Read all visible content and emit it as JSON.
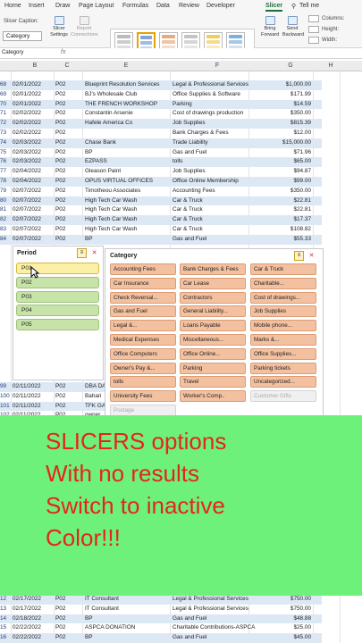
{
  "ribbon_tabs": [
    "Home",
    "Insert",
    "Draw",
    "Page Layout",
    "Formulas",
    "Data",
    "Review",
    "Developer",
    "Slicer",
    "Tell me"
  ],
  "ribbon": {
    "caption_label": "Slicer Caption:",
    "caption_value": "Category",
    "slicer_settings": "Slicer Settings",
    "report_connections": "Report Connections",
    "bring_forward": "Bring Forward",
    "send_backward": "Send Backward",
    "columns_label": "Columns:",
    "height_label": "Height:",
    "width_label": "Width:"
  },
  "formula_bar": {
    "name_box": "Category",
    "fx": "fx"
  },
  "columns": [
    "B",
    "C",
    "E",
    "F",
    "G",
    "H"
  ],
  "rows_top": [
    {
      "n": "68",
      "date": "02/01/2022",
      "p": "P02",
      "payee": "Blueprint Resolution Services",
      "cat": "Legal & Professional Services",
      "amt": "$1,000.00"
    },
    {
      "n": "69",
      "date": "02/01/2022",
      "p": "P02",
      "payee": "BJ's Wholesale Club",
      "cat": "Office Supplies & Software",
      "amt": "$171.99"
    },
    {
      "n": "70",
      "date": "02/01/2022",
      "p": "P02",
      "payee": "THE FRENCH WORKSHOP",
      "cat": "Parking",
      "amt": "$14.59"
    },
    {
      "n": "71",
      "date": "02/02/2022",
      "p": "P02",
      "payee": "Constantin Arsenie",
      "cat": "Cost of drawings production",
      "amt": "$350.00"
    },
    {
      "n": "72",
      "date": "02/02/2022",
      "p": "P02",
      "payee": "Hafele America Co",
      "cat": "Job Supplies",
      "amt": "$815.39"
    },
    {
      "n": "73",
      "date": "02/02/2022",
      "p": "P02",
      "payee": "",
      "cat": "Bank Charges & Fees",
      "amt": "$12.00"
    },
    {
      "n": "74",
      "date": "02/03/2022",
      "p": "P02",
      "payee": "Chase Bank",
      "cat": "Trade Liability",
      "amt": "$15,000.00"
    },
    {
      "n": "75",
      "date": "02/03/2022",
      "p": "P02",
      "payee": "BP",
      "cat": "Gas and Fuel",
      "amt": "$71.96"
    },
    {
      "n": "76",
      "date": "02/03/2022",
      "p": "P02",
      "payee": "EZPASS",
      "cat": "tolls",
      "amt": "$65.00"
    },
    {
      "n": "77",
      "date": "02/04/2022",
      "p": "P02",
      "payee": "Gleason Paint",
      "cat": "Job Supplies",
      "amt": "$94.87"
    },
    {
      "n": "78",
      "date": "02/04/2022",
      "p": "P02",
      "payee": "OPUS VIRTUAL OFFICES",
      "cat": "Office Online Membership",
      "amt": "$99.00"
    },
    {
      "n": "79",
      "date": "02/07/2022",
      "p": "P02",
      "payee": "Timotheou Associates",
      "cat": "Accounting Fees",
      "amt": "$350.00"
    },
    {
      "n": "80",
      "date": "02/07/2022",
      "p": "P02",
      "payee": "High Tech Car Wash",
      "cat": "Car & Truck",
      "amt": "$22.81"
    },
    {
      "n": "81",
      "date": "02/07/2022",
      "p": "P02",
      "payee": "High Tech Car Wash",
      "cat": "Car & Truck",
      "amt": "$22.81"
    },
    {
      "n": "82",
      "date": "02/07/2022",
      "p": "P02",
      "payee": "High Tech Car Wash",
      "cat": "Car & Truck",
      "amt": "$17.37"
    },
    {
      "n": "83",
      "date": "02/07/2022",
      "p": "P02",
      "payee": "High Tech Car Wash",
      "cat": "Car & Truck",
      "amt": "$108.82"
    },
    {
      "n": "84",
      "date": "02/07/2022",
      "p": "P02",
      "payee": "BP",
      "cat": "Gas and Fuel",
      "amt": "$55.33"
    }
  ],
  "rows_mid": [
    {
      "n": "99",
      "date": "02/11/2022",
      "p": "P02",
      "payee": "DBA DA"
    },
    {
      "n": "100",
      "date": "02/11/2022",
      "p": "P02",
      "payee": "Bahari"
    },
    {
      "n": "101",
      "date": "02/11/2022",
      "p": "P02",
      "payee": "TFK GA"
    },
    {
      "n": "102",
      "date": "02/11/2022",
      "p": "P02",
      "payee": "owner"
    }
  ],
  "rows_bottom": [
    {
      "n": "12",
      "date": "02/17/2022",
      "p": "P02",
      "payee": "IT Consultant",
      "cat": "Legal & Professional Services",
      "amt": "$750.00"
    },
    {
      "n": "13",
      "date": "02/17/2022",
      "p": "P02",
      "payee": "IT Consultant",
      "cat": "Legal & Professional Services",
      "amt": "$750.00"
    },
    {
      "n": "14",
      "date": "02/18/2022",
      "p": "P02",
      "payee": "BP",
      "cat": "Gas and Fuel",
      "amt": "$48.88"
    },
    {
      "n": "15",
      "date": "02/22/2022",
      "p": "P02",
      "payee": "ASPCA DONATION",
      "cat": "Charitable Contributions-ASPCA",
      "amt": "$25.00"
    },
    {
      "n": "16",
      "date": "02/22/2022",
      "p": "P02",
      "payee": "BP",
      "cat": "Gas and Fuel",
      "amt": "$45.00"
    }
  ],
  "period_slicer": {
    "title": "Period",
    "items": [
      "P01",
      "P02",
      "P03",
      "P04",
      "P05"
    ],
    "selected": "P01"
  },
  "category_slicer": {
    "title": "Category",
    "items": [
      "Accounting Fees",
      "Bank Charges & Fees",
      "Car & Truck",
      "Car Insurance",
      "Car Lease",
      "Charitable...",
      "Check Reversal...",
      "Contractors",
      "Cost of drawings...",
      "Gas and Fuel",
      "General Liability...",
      "Job Supplies",
      "Legal &...",
      "Loans Payable",
      "Mobile phone...",
      "Medical Expenses",
      "Miscellaneous...",
      "Marks &...",
      "Office Computers",
      "Office Online...",
      "Office Supplies...",
      "Owner's Pay &...",
      "Parking",
      "Parking tickets",
      "tolls",
      "Travel",
      "Uncategorized...",
      "University Fees",
      "Worker's Comp..",
      "Customer Gifts",
      "Postage"
    ],
    "inactive": [
      "Customer Gifts",
      "Postage"
    ]
  },
  "overlay_lines": [
    "SLICERS options",
    "With no results",
    "Switch to inactive",
    "Color!!!"
  ],
  "colors": {
    "overlay_bg": "#6ef17a",
    "overlay_text": "#e3261b",
    "active_button": "#f4c1a0",
    "period_button": "#c7e3a8",
    "selected_button": "#fbf0a6"
  }
}
